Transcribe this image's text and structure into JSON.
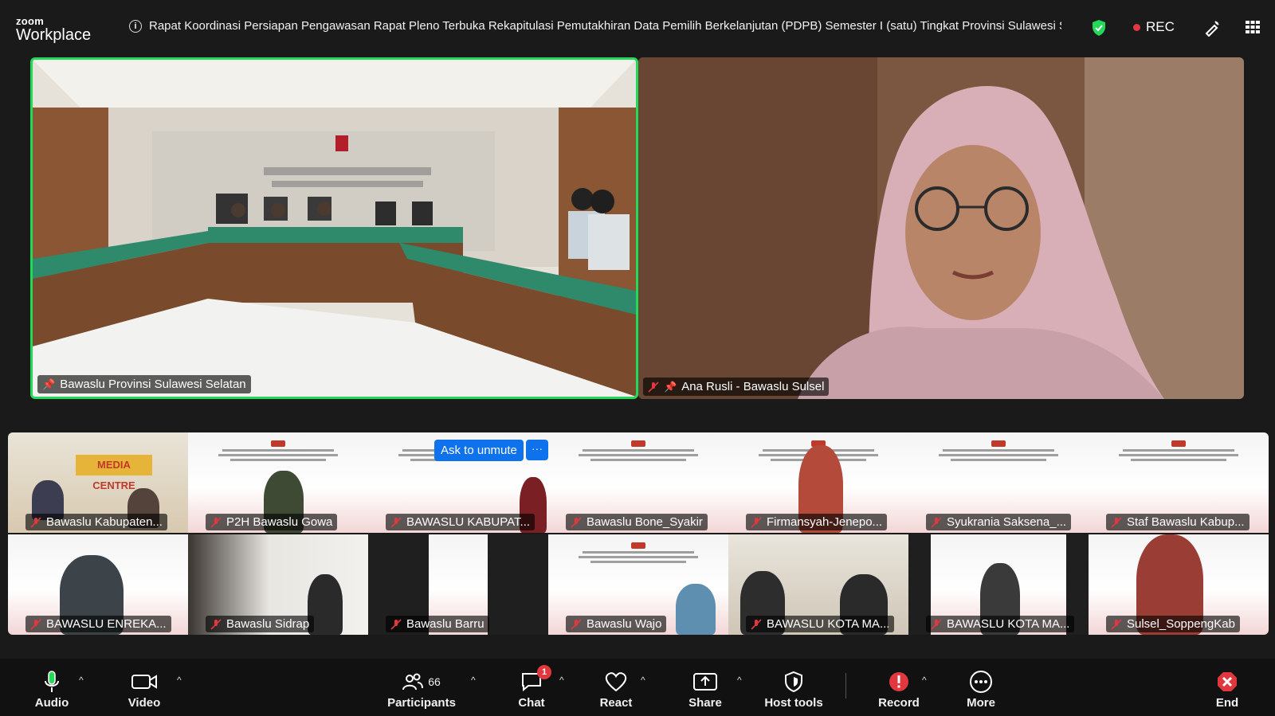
{
  "app": {
    "logo_top": "zoom",
    "logo_bottom": "Workplace"
  },
  "meeting": {
    "title": "Rapat Koordinasi Persiapan Pengawasan Rapat Pleno Terbuka Rekapitulasi Pemutakhiran Data Pemilih Berkelanjutan (PDPB) Semester I (satu) Tingkat Provinsi Sulawesi Selata"
  },
  "status": {
    "rec_label": "REC",
    "accent": "#23d959",
    "rec_color": "#e0383e"
  },
  "main_videos": [
    {
      "name": "Bawaslu Provinsi Sulawesi Selatan",
      "pinned": true,
      "muted": false,
      "active_speaker": true
    },
    {
      "name": "Ana Rusli - Bawaslu Sulsel",
      "pinned": true,
      "muted": true
    }
  ],
  "gallery": [
    {
      "name": "Bawaslu Kabupaten..."
    },
    {
      "name": "P2H Bawaslu Gowa"
    },
    {
      "name": "BAWASLU KABUPAT..."
    },
    {
      "name": "Bawaslu Bone_Syakir"
    },
    {
      "name": "Firmansyah-Jenepo..."
    },
    {
      "name": "Syukrania Saksena_..."
    },
    {
      "name": "Staf Bawaslu Kabup..."
    },
    {
      "name": "BAWASLU ENREKA..."
    },
    {
      "name": "Bawaslu Sidrap"
    },
    {
      "name": "Bawaslu Barru"
    },
    {
      "name": "Bawaslu Wajo"
    },
    {
      "name": "BAWASLU KOTA MA..."
    },
    {
      "name": "BAWASLU KOTA MA..."
    },
    {
      "name": "Sulsel_SoppengKab"
    }
  ],
  "overlay": {
    "ask_unmute": "Ask to unmute",
    "more": "···"
  },
  "toolbar": {
    "audio": "Audio",
    "video": "Video",
    "participants": "Participants",
    "participants_count": "66",
    "chat": "Chat",
    "chat_badge": "1",
    "react": "React",
    "share": "Share",
    "host_tools": "Host tools",
    "record": "Record",
    "record_badge": "!",
    "more": "More",
    "end": "End"
  }
}
